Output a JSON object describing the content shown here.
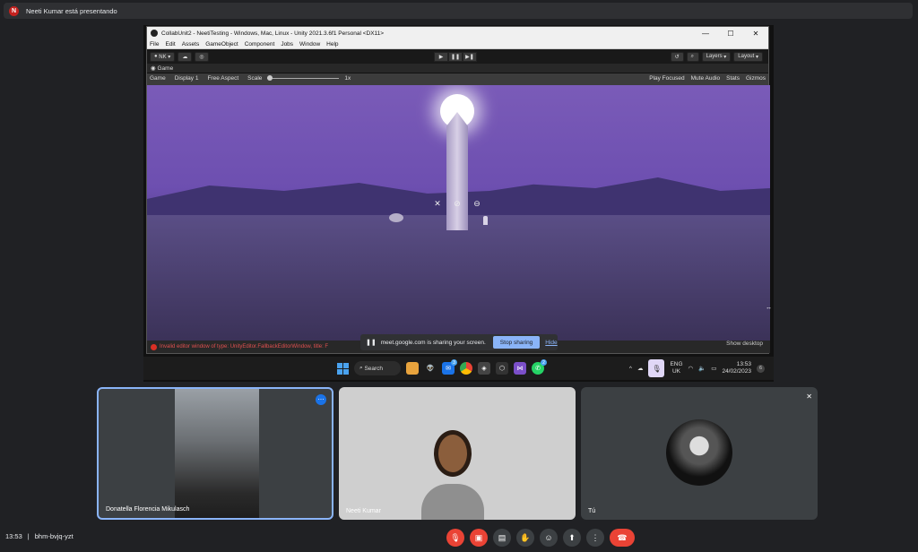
{
  "topbar": {
    "avatar_letter": "N",
    "presenting_text": "Neeti Kumar está presentando"
  },
  "unity": {
    "title": "CollabUnit2 - NeetiTesting - Windows, Mac, Linux - Unity 2021.3.6f1 Personal <DX11>",
    "window_controls": [
      "—",
      "☐",
      "✕"
    ],
    "menu": [
      "File",
      "Edit",
      "Assets",
      "GameObject",
      "Component",
      "Jobs",
      "Window",
      "Help"
    ],
    "toolbar": {
      "account": "NK ▾",
      "layers": "Layers",
      "layout": "Layout"
    },
    "game_tab": "Game",
    "game_options": {
      "display_mode": "Game",
      "display": "Display 1",
      "aspect": "Free Aspect",
      "scale_label": "Scale",
      "scale_value": "1x",
      "play_focused": "Play Focused",
      "mute_audio": "Mute Audio",
      "stats": "Stats",
      "gizmos": "Gizmos"
    },
    "status_error": "Invalid editor window of type: UnityEditor.FallbackEditorWindow, title: F",
    "show_desktop": "Show desktop"
  },
  "share_notice": {
    "text": "meet.google.com is sharing your screen.",
    "stop_label": "Stop sharing",
    "hide_label": "Hide"
  },
  "taskbar": {
    "search_label": "Search",
    "mail_badge": "3",
    "whatsapp_badge": "2",
    "lang_line1": "ENG",
    "lang_line2": "UK",
    "time": "13:53",
    "date": "24/02/2023",
    "notif_count": "6"
  },
  "participants": [
    {
      "name": "Donatella Florencia Mikulasch"
    },
    {
      "name": "Neeti Kumar"
    },
    {
      "name": "Tú"
    }
  ],
  "bottom": {
    "time": "13:53",
    "separator": "|",
    "meeting_code": "bhm-bvjq-yzt"
  }
}
